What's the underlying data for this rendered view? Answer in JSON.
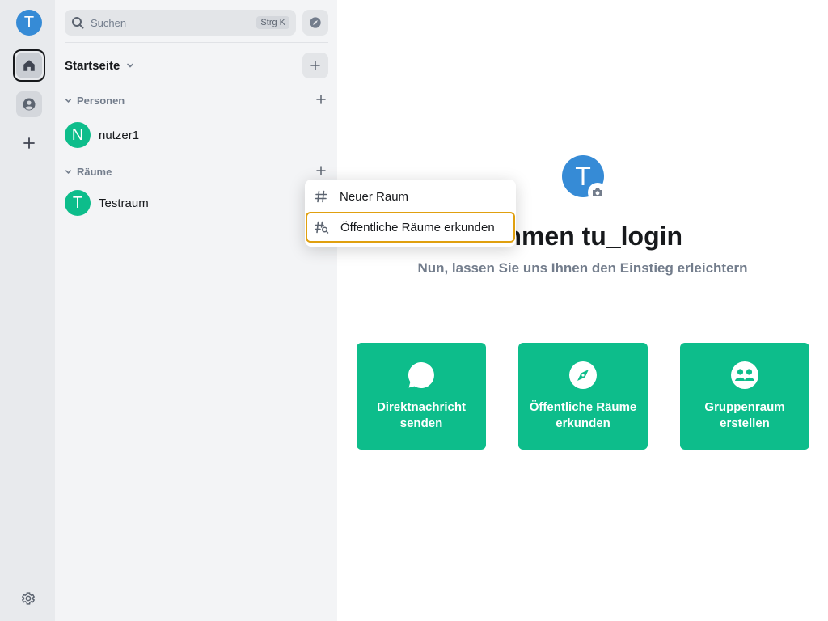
{
  "spacebar": {
    "user_initial": "T"
  },
  "roomlist": {
    "search_placeholder": "Suchen",
    "search_shortcut": "Strg K",
    "home_title": "Startseite",
    "sections": [
      {
        "title": "Personen",
        "rooms": [
          {
            "initial": "N",
            "name": "nutzer1"
          }
        ]
      },
      {
        "title": "Räume",
        "rooms": [
          {
            "initial": "T",
            "name": "Testraum"
          }
        ]
      }
    ]
  },
  "context_menu": {
    "items": [
      {
        "label": "Neuer Raum",
        "icon": "hash-icon"
      },
      {
        "label": "Öffentliche Räume erkunden",
        "icon": "hash-search-icon",
        "focused": true
      }
    ]
  },
  "home": {
    "avatar_initial": "T",
    "welcome": "ommen tu_login",
    "subtitle": "Nun, lassen Sie uns Ihnen den Einstieg erleichtern",
    "cards": [
      {
        "label": "Direktnachricht senden",
        "icon": "chat-bubble-icon"
      },
      {
        "label": "Öffentliche Räume erkunden",
        "icon": "compass-icon"
      },
      {
        "label": "Gruppenraum erstellen",
        "icon": "group-icon"
      }
    ]
  },
  "colors": {
    "accent": "#0dbd8b",
    "avatar_blue": "#368bd6",
    "focus_ring": "#e0a00f"
  }
}
